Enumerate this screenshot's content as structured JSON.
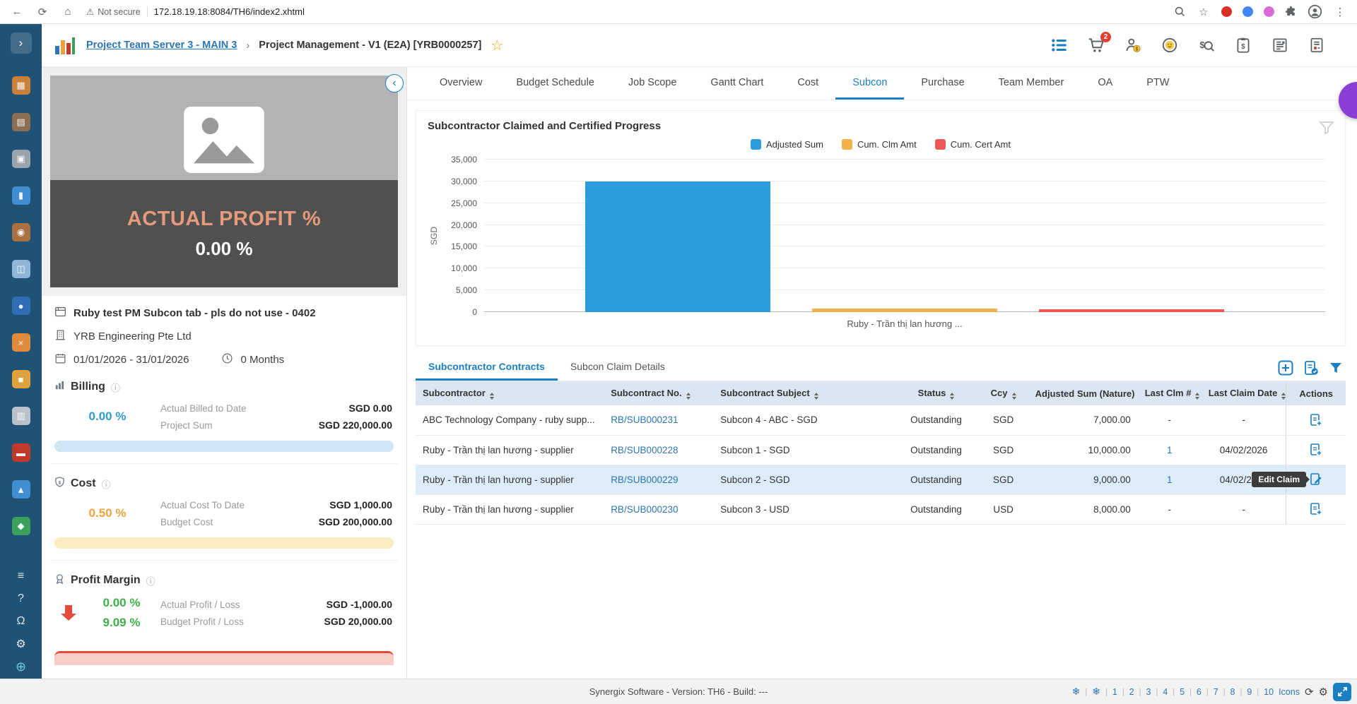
{
  "browser": {
    "security_label": "Not secure",
    "url": "172.18.19.18:8084/TH6/index2.xhtml"
  },
  "icons": {
    "back-icon": "←",
    "refresh-icon": "⟳",
    "home-icon": "⌂",
    "warning-icon": "⚠",
    "bookmark-star-icon": "☆",
    "menu-dots-icon": "⋮",
    "favorite-star-icon": "☆",
    "collapse-icon": "‹",
    "expand-icon": "›",
    "snowflake-icon": "❄",
    "refresh-footer-icon": "⟳",
    "settings-gear-icon": "⚙",
    "info-icon": "ⓘ"
  },
  "app_header": {
    "breadcrumb_root": "Project Team Server 3 - MAIN 3",
    "breadcrumb_separator": "›",
    "breadcrumb_current": "Project Management - V1 (E2A) [YRB0000257]",
    "cart_badge": "2"
  },
  "sidebar": {
    "items": [
      {
        "name": "projects-icon",
        "glyph": "▦",
        "color": "#c9803a"
      },
      {
        "name": "archive-icon",
        "glyph": "▤",
        "color": "#8a6f52"
      },
      {
        "name": "gallery-icon",
        "glyph": "▣",
        "color": "#9aa4ad"
      },
      {
        "name": "torch-icon",
        "glyph": "▮",
        "color": "#3f8fd2"
      },
      {
        "name": "team-icon",
        "glyph": "◉",
        "color": "#a9713f"
      },
      {
        "name": "photos-icon",
        "glyph": "◫",
        "color": "#8fb6d9"
      },
      {
        "name": "apps-icon",
        "glyph": "●",
        "color": "#2f6db5"
      },
      {
        "name": "tools-icon",
        "glyph": "×",
        "color": "#e08a3c"
      },
      {
        "name": "package-icon",
        "glyph": "■",
        "color": "#e0a23c"
      },
      {
        "name": "clipboard-icon",
        "glyph": "▥",
        "color": "#b9c2cb"
      },
      {
        "name": "briefcase-icon",
        "glyph": "▬",
        "color": "#c0392b"
      },
      {
        "name": "cart-side-icon",
        "glyph": "▲",
        "color": "#3f8fd2"
      },
      {
        "name": "folder-icon",
        "glyph": "◆",
        "color": "#3aa05a"
      }
    ],
    "bottom": [
      {
        "name": "menu-icon",
        "glyph": "≡"
      },
      {
        "name": "help-icon",
        "glyph": "?"
      },
      {
        "name": "bell-icon",
        "glyph": "Ω"
      },
      {
        "name": "gear-icon",
        "glyph": "⚙"
      },
      {
        "name": "globe-icon",
        "glyph": "⊕"
      }
    ]
  },
  "nav_tabs": {
    "items": [
      "Overview",
      "Budget Schedule",
      "Job Scope",
      "Gantt Chart",
      "Cost",
      "Subcon",
      "Purchase",
      "Team Member",
      "OA",
      "PTW"
    ],
    "active": "Subcon"
  },
  "project_panel": {
    "overlay_title": "ACTUAL PROFIT %",
    "overlay_value": "0.00 %",
    "project_name": "Ruby test PM Subcon tab - pls do not use - 0402",
    "company": "YRB Engineering Pte Ltd",
    "date_range": "01/01/2026 - 31/01/2026",
    "duration": "0 Months",
    "billing": {
      "title": "Billing",
      "percent": "0.00 %",
      "rows": [
        {
          "label": "Actual Billed to Date",
          "value": "SGD 0.00"
        },
        {
          "label": "Project Sum",
          "value": "SGD 220,000.00"
        }
      ]
    },
    "cost": {
      "title": "Cost",
      "percent": "0.50 %",
      "rows": [
        {
          "label": "Actual Cost To Date",
          "value": "SGD 1,000.00"
        },
        {
          "label": "Budget Cost",
          "value": "SGD 200,000.00"
        }
      ]
    },
    "profit": {
      "title": "Profit Margin",
      "percent_actual": "0.00 %",
      "percent_budget": "9.09 %",
      "rows": [
        {
          "label": "Actual Profit / Loss",
          "value": "SGD -1,000.00"
        },
        {
          "label": "Budget Profit / Loss",
          "value": "SGD 20,000.00"
        }
      ]
    }
  },
  "chart_data": {
    "type": "bar",
    "title": "Subcontractor Claimed and Certified Progress",
    "categories": [
      "Ruby - Trần thị lan hương ..."
    ],
    "series": [
      {
        "name": "Adjusted Sum",
        "color": "#2d9cdb",
        "values": [
          30000
        ]
      },
      {
        "name": "Cum. Clm Amt",
        "color": "#f2b04c",
        "values": [
          800
        ]
      },
      {
        "name": "Cum. Cert Amt",
        "color": "#eb5757",
        "values": [
          700
        ]
      }
    ],
    "xlabel": "",
    "ylabel": "SGD",
    "ylim": [
      0,
      35000
    ],
    "yticks": [
      0,
      5000,
      10000,
      15000,
      20000,
      25000,
      30000,
      35000
    ],
    "grid": true,
    "legend_position": "top"
  },
  "table_section": {
    "tabs": [
      "Subcontractor Contracts",
      "Subcon Claim Details"
    ],
    "active_tab": "Subcontractor Contracts",
    "columns": [
      "Subcontractor",
      "Subcontract No.",
      "Subcontract Subject",
      "Status",
      "Ccy",
      "Adjusted Sum (Nature)",
      "Last Clm #",
      "Last Claim Date",
      "Actions"
    ],
    "rows": [
      {
        "subcontractor": "ABC Technology Company - ruby supp...",
        "no": "RB/SUB000231",
        "subject": "Subcon 4 - ABC - SGD",
        "status": "Outstanding",
        "ccy": "SGD",
        "adjusted_sum": "7,000.00",
        "last_clm": "-",
        "last_claim_date": "-",
        "action_icon": "add-claim-icon",
        "highlighted": false
      },
      {
        "subcontractor": "Ruby - Trần thị lan hương - supplier",
        "no": "RB/SUB000228",
        "subject": "Subcon 1 - SGD",
        "status": "Outstanding",
        "ccy": "SGD",
        "adjusted_sum": "10,000.00",
        "last_clm": "1",
        "last_claim_date": "04/02/2026",
        "action_icon": "add-claim-icon",
        "highlighted": false
      },
      {
        "subcontractor": "Ruby - Trần thị lan hương - supplier",
        "no": "RB/SUB000229",
        "subject": "Subcon 2 - SGD",
        "status": "Outstanding",
        "ccy": "SGD",
        "adjusted_sum": "9,000.00",
        "last_clm": "1",
        "last_claim_date": "04/02/2026",
        "action_icon": "edit-claim-icon",
        "highlighted": true
      },
      {
        "subcontractor": "Ruby - Trần thị lan hương - supplier",
        "no": "RB/SUB000230",
        "subject": "Subcon 3 - USD",
        "status": "Outstanding",
        "ccy": "USD",
        "adjusted_sum": "8,000.00",
        "last_clm": "-",
        "last_claim_date": "-",
        "action_icon": "add-claim-icon",
        "highlighted": false
      }
    ],
    "tooltip": "Edit Claim"
  },
  "footer": {
    "center_text": "Synergix Software - Version: TH6 - Build: ---",
    "pagination": [
      "1",
      "2",
      "3",
      "4",
      "5",
      "6",
      "7",
      "8",
      "9",
      "10"
    ],
    "icons_label": "Icons"
  },
  "colors": {
    "accent_blue": "#1b7fc4",
    "link_blue": "#2e75b6",
    "sidebar_bg": "#1f5274",
    "bar_blue": "#2d9cdb",
    "bar_orange": "#f2b04c",
    "bar_red": "#eb5757",
    "billing_percent": "#2e9ad0",
    "cost_percent": "#f2a33c",
    "profit_percent": "#3fae49",
    "negative_red": "#e64a3c",
    "badge_red": "#e23d2e",
    "table_header_bg": "#dbe6f2",
    "row_highlight": "#dcecf9"
  }
}
